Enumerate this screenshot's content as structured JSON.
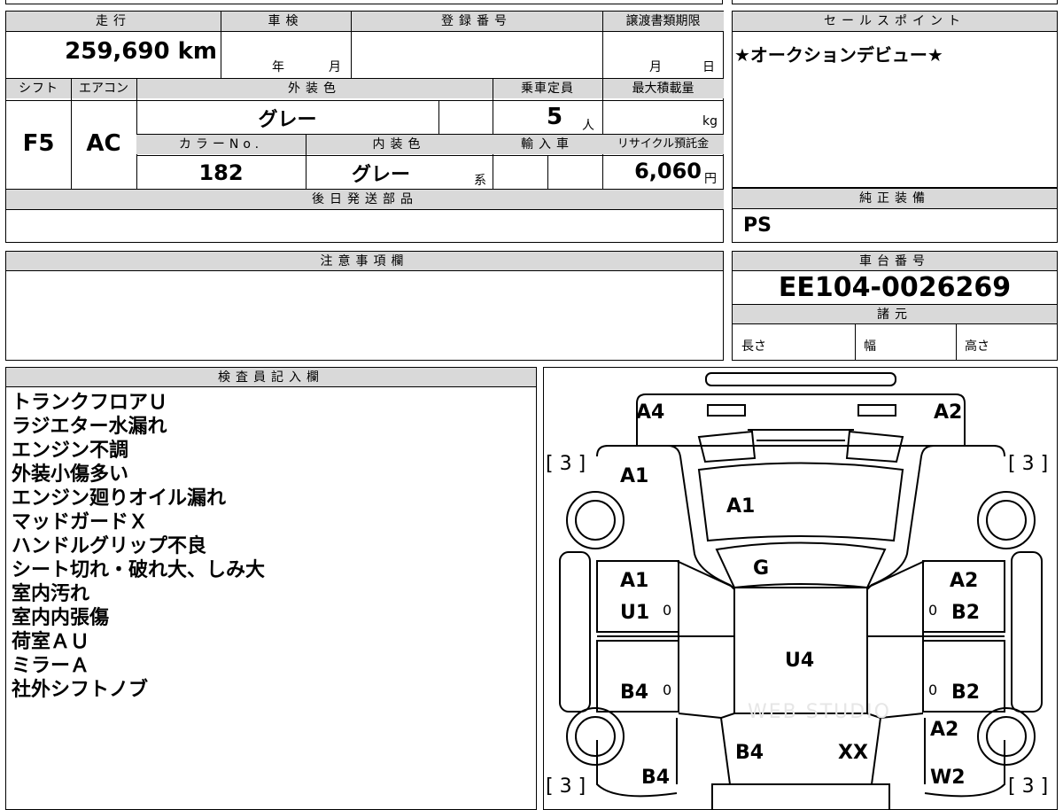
{
  "info": {
    "headers": {
      "mileage": "走行",
      "inspection": "車検",
      "registration": "登録番号",
      "transfer_deadline": "譲渡書類期限",
      "shift": "シフト",
      "aircon": "エアコン",
      "exterior_color": "外装色",
      "capacity": "乗車定員",
      "max_load": "最大積載量",
      "color_no": "カラーNo.",
      "interior_color": "内装色",
      "import": "輸入車",
      "recycle": "リサイクル預託金",
      "later_parts": "後日発送部品",
      "notes": "注意事項欄",
      "inspector": "検査員記入欄"
    },
    "mileage_value": "259,690 km",
    "inspection_year": "年",
    "inspection_month": "月",
    "transfer_month": "月",
    "transfer_day": "日",
    "shift_value": "F5",
    "aircon_value": "AC",
    "exterior_value": "グレー",
    "capacity_value": "5",
    "capacity_unit": "人",
    "max_load_unit": "kg",
    "color_no_value": "182",
    "interior_value": "グレー",
    "interior_suffix": "系",
    "recycle_value": "6,060",
    "recycle_unit": "円"
  },
  "sales": {
    "header": "セールスポイント",
    "text": "★オークションデビュー★"
  },
  "equipment": {
    "header": "純正装備",
    "value": "PS"
  },
  "chassis": {
    "header": "車台番号",
    "value": "EE104-0026269",
    "specs_header": "諸元",
    "length": "長さ",
    "width": "幅",
    "height": "高さ"
  },
  "inspector_notes": [
    "トランクフロアＵ",
    "ラジエター水漏れ",
    "エンジン不調",
    "外装小傷多い",
    "エンジン廻りオイル漏れ",
    "マッドガードＸ",
    "ハンドルグリップ不良",
    "シート切れ・破れ大、しみ大",
    "室内汚れ",
    "室内内張傷",
    "荷室ＡＵ",
    "ミラーＡ",
    "社外シフトノブ"
  ],
  "diagram": {
    "tires": [
      "[ 3 ]",
      "[ 3 ]",
      "[ 3 ]",
      "[ 3 ]"
    ],
    "marks": {
      "front_left": "A4",
      "front_right": "A2",
      "fender_left": "A1",
      "hood": "A1",
      "windshield": "G",
      "door_front_left": "A1",
      "rocker_left_1": "U1",
      "door_front_right": "A2",
      "rocker_right_1": "B2",
      "roof": "U4",
      "door_rear_left": "B4",
      "door_rear_right": "B2",
      "quarter_right": "A2",
      "trunk_left": "B4",
      "trunk_right": "XX",
      "rear_left": "B4",
      "rear_right": "W2"
    },
    "zeros": [
      "0",
      "0",
      "0",
      "0"
    ],
    "watermark": "WEB STUDIO"
  }
}
